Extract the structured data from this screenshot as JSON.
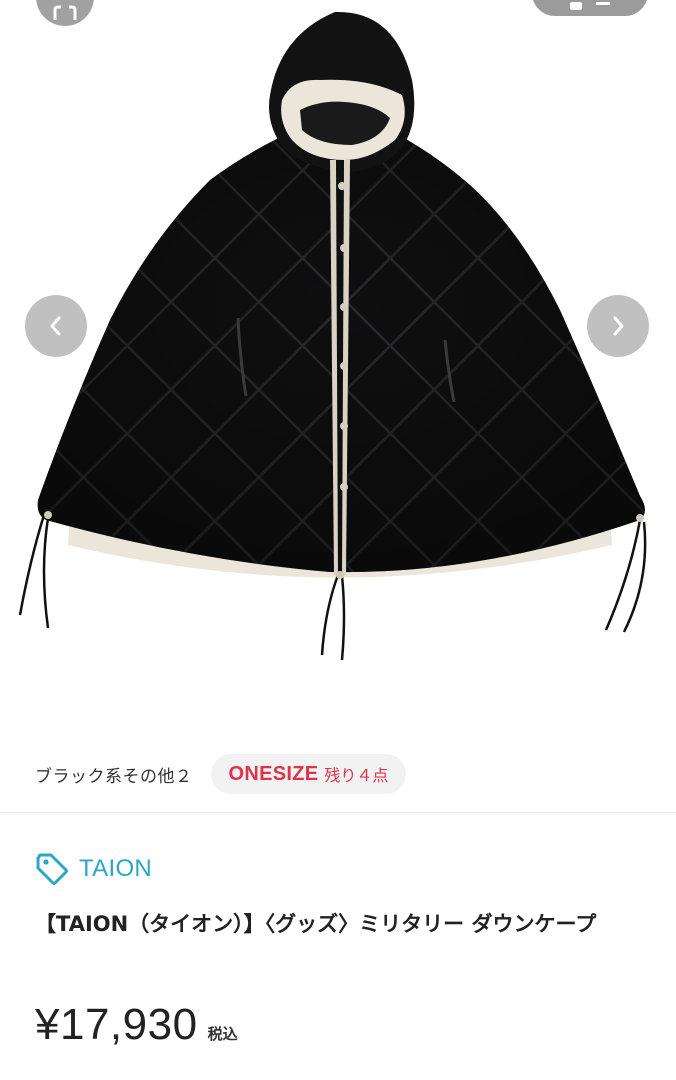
{
  "gallery": {
    "image_alt": "Black quilted down cape with hood",
    "colors": {
      "cape": "#0f0f10",
      "lining": "#ece6da",
      "nav_button": "#8c8c8c"
    },
    "prev_icon": "chevron-left-icon",
    "next_icon": "chevron-right-icon"
  },
  "variant": {
    "color": "ブラック系その他２",
    "size": "ONESIZE",
    "stock": "残り４点"
  },
  "brand": {
    "icon": "tag-icon",
    "name": "TAION",
    "color": "#2aa6c9"
  },
  "product": {
    "title": "【TAION（タイオン）】〈グッズ〉ミリタリー ダウンケープ"
  },
  "price": {
    "amount": "¥17,930",
    "tax_label": "税込"
  },
  "accent_color": "#e0334a"
}
